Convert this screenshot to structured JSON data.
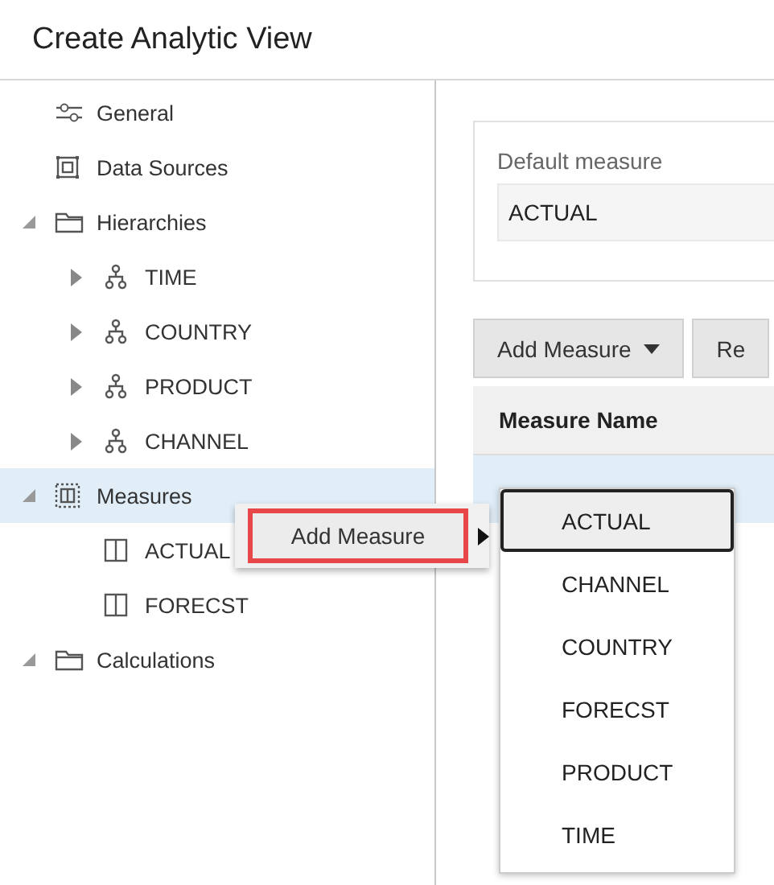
{
  "window": {
    "title": "Create Analytic View"
  },
  "tree": [
    {
      "label": "General",
      "kind": "settings",
      "selected": false
    },
    {
      "label": "Data Sources",
      "kind": "datasource",
      "selected": false
    },
    {
      "label": "Hierarchies",
      "kind": "folder",
      "expanded": true,
      "selected": false,
      "children": [
        {
          "label": "TIME",
          "kind": "hierarchy",
          "expanded": false,
          "selected": false
        },
        {
          "label": "COUNTRY",
          "kind": "hierarchy",
          "expanded": false,
          "selected": false
        },
        {
          "label": "PRODUCT",
          "kind": "hierarchy",
          "expanded": false,
          "selected": false
        },
        {
          "label": "CHANNEL",
          "kind": "hierarchy",
          "expanded": false,
          "selected": false
        }
      ]
    },
    {
      "label": "Measures",
      "kind": "measures",
      "expanded": true,
      "selected": true,
      "children": [
        {
          "label": "ACTUAL",
          "kind": "measure",
          "selected": false
        },
        {
          "label": "FORECST",
          "kind": "measure",
          "selected": false
        }
      ]
    },
    {
      "label": "Calculations",
      "kind": "folder",
      "expanded": true,
      "selected": false
    }
  ],
  "default_measure": {
    "label": "Default measure",
    "value": "ACTUAL"
  },
  "toolbar": [
    {
      "label": "Add Measure",
      "dropdown": true
    },
    {
      "label": "Re",
      "dropdown": false
    }
  ],
  "table": {
    "columns": [
      "Measure Name"
    ],
    "rows": [
      {
        "selected": true
      }
    ]
  },
  "context_menu": {
    "items": [
      {
        "label": "Add Measure",
        "highlighted": true,
        "submenu": true
      }
    ]
  },
  "submenu": {
    "items": [
      {
        "label": "ACTUAL",
        "selected": true
      },
      {
        "label": "CHANNEL",
        "selected": false
      },
      {
        "label": "COUNTRY",
        "selected": false
      },
      {
        "label": "FORECST",
        "selected": false
      },
      {
        "label": "PRODUCT",
        "selected": false
      },
      {
        "label": "TIME",
        "selected": false
      }
    ]
  }
}
